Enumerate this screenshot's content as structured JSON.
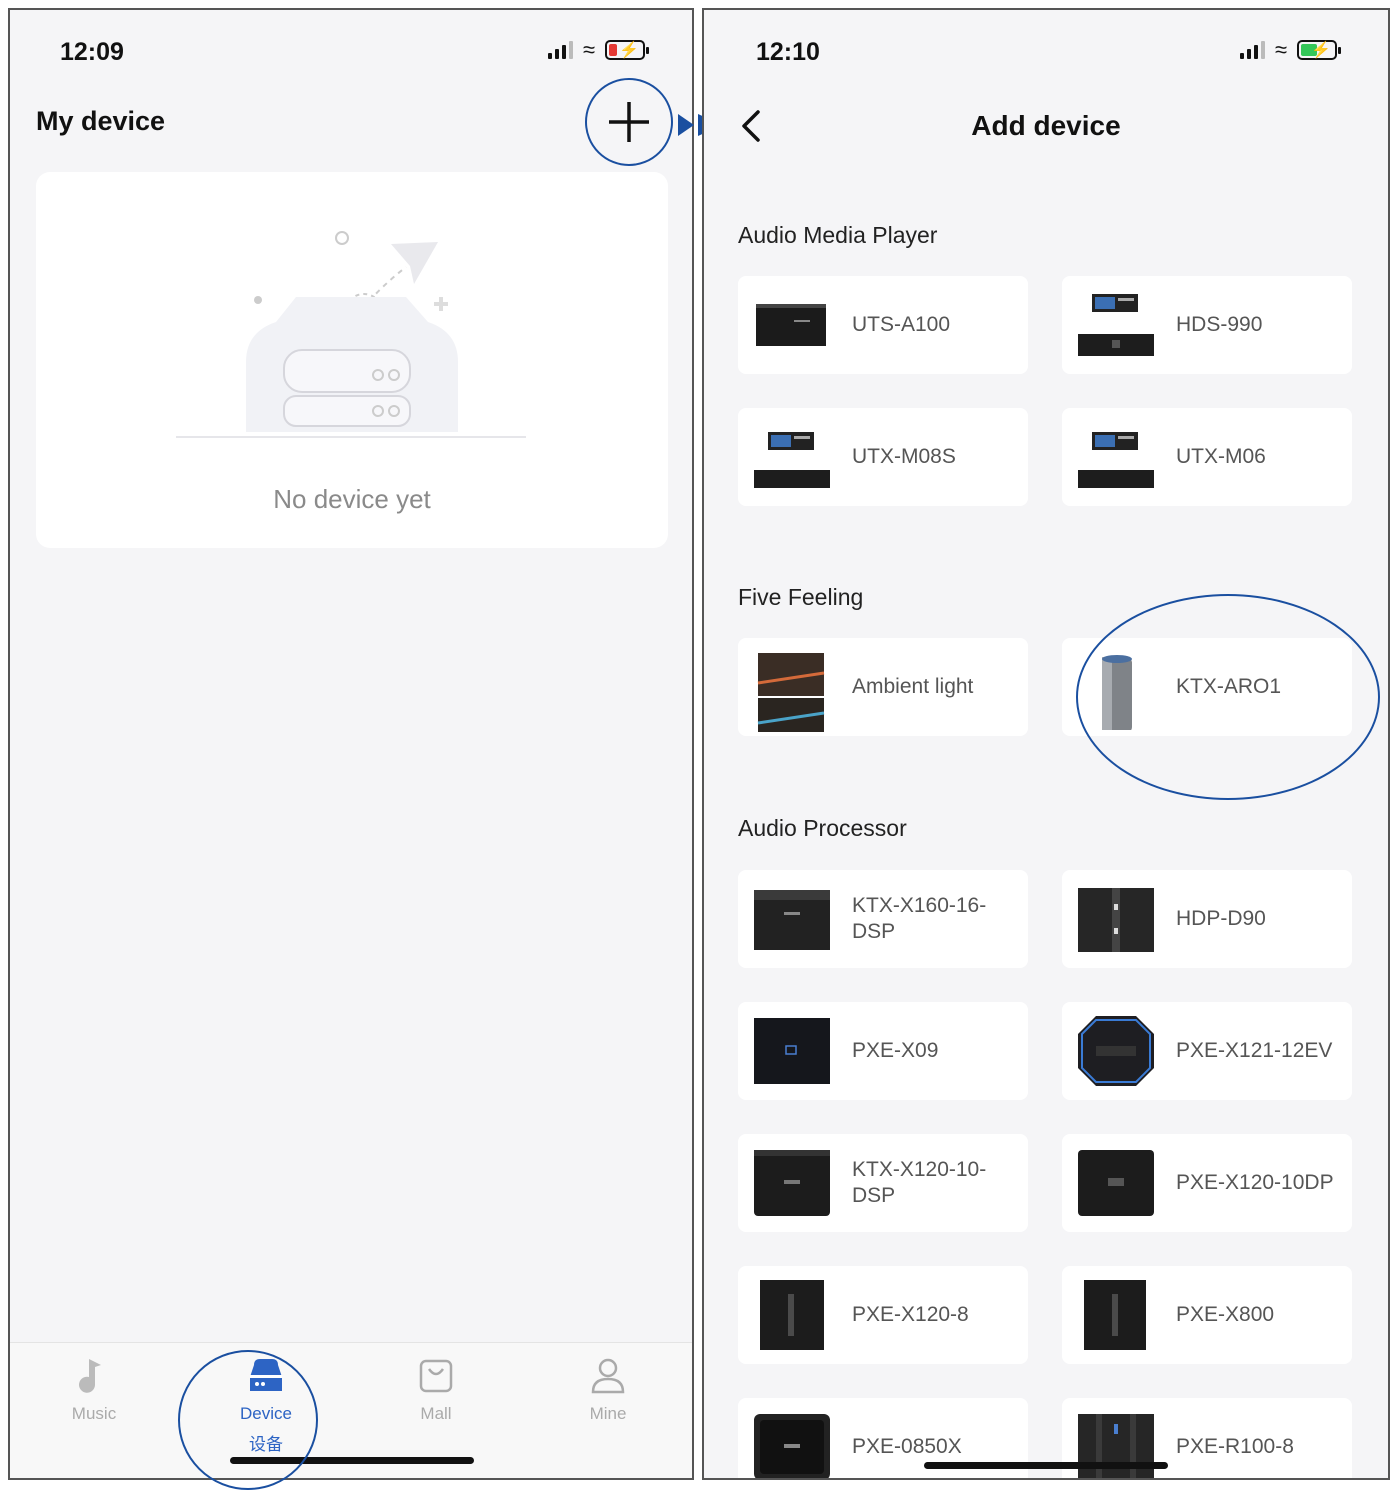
{
  "left": {
    "time": "12:09",
    "title": "My device",
    "empty_text": "No device yet",
    "tabs": [
      {
        "label": "Music",
        "icon": "music-note-icon"
      },
      {
        "label": "Device",
        "sub": "设备",
        "icon": "device-icon",
        "active": true
      },
      {
        "label": "Mall",
        "icon": "shopping-bag-icon"
      },
      {
        "label": "Mine",
        "icon": "person-icon"
      }
    ]
  },
  "right": {
    "time": "12:10",
    "title": "Add device",
    "sections": [
      {
        "title": "Audio Media Player",
        "devices": [
          "UTS-A100",
          "HDS-990",
          "UTX-M08S",
          "UTX-M06"
        ]
      },
      {
        "title": "Five Feeling",
        "devices": [
          "Ambient light",
          "KTX-ARO1"
        ]
      },
      {
        "title": "Audio Processor",
        "devices": [
          "KTX-X160-16-DSP",
          "HDP-D90",
          "PXE-X09",
          "PXE-X121-12EV",
          "KTX-X120-10-DSP",
          "PXE-X120-10DP",
          "PXE-X120-8",
          "PXE-X800",
          "PXE-0850X",
          "PXE-R100-8"
        ]
      }
    ]
  },
  "colors": {
    "accent": "#2d64c4",
    "annotation": "#1a4fa0",
    "battery_low": "#e53935",
    "battery_ok": "#34c759"
  }
}
